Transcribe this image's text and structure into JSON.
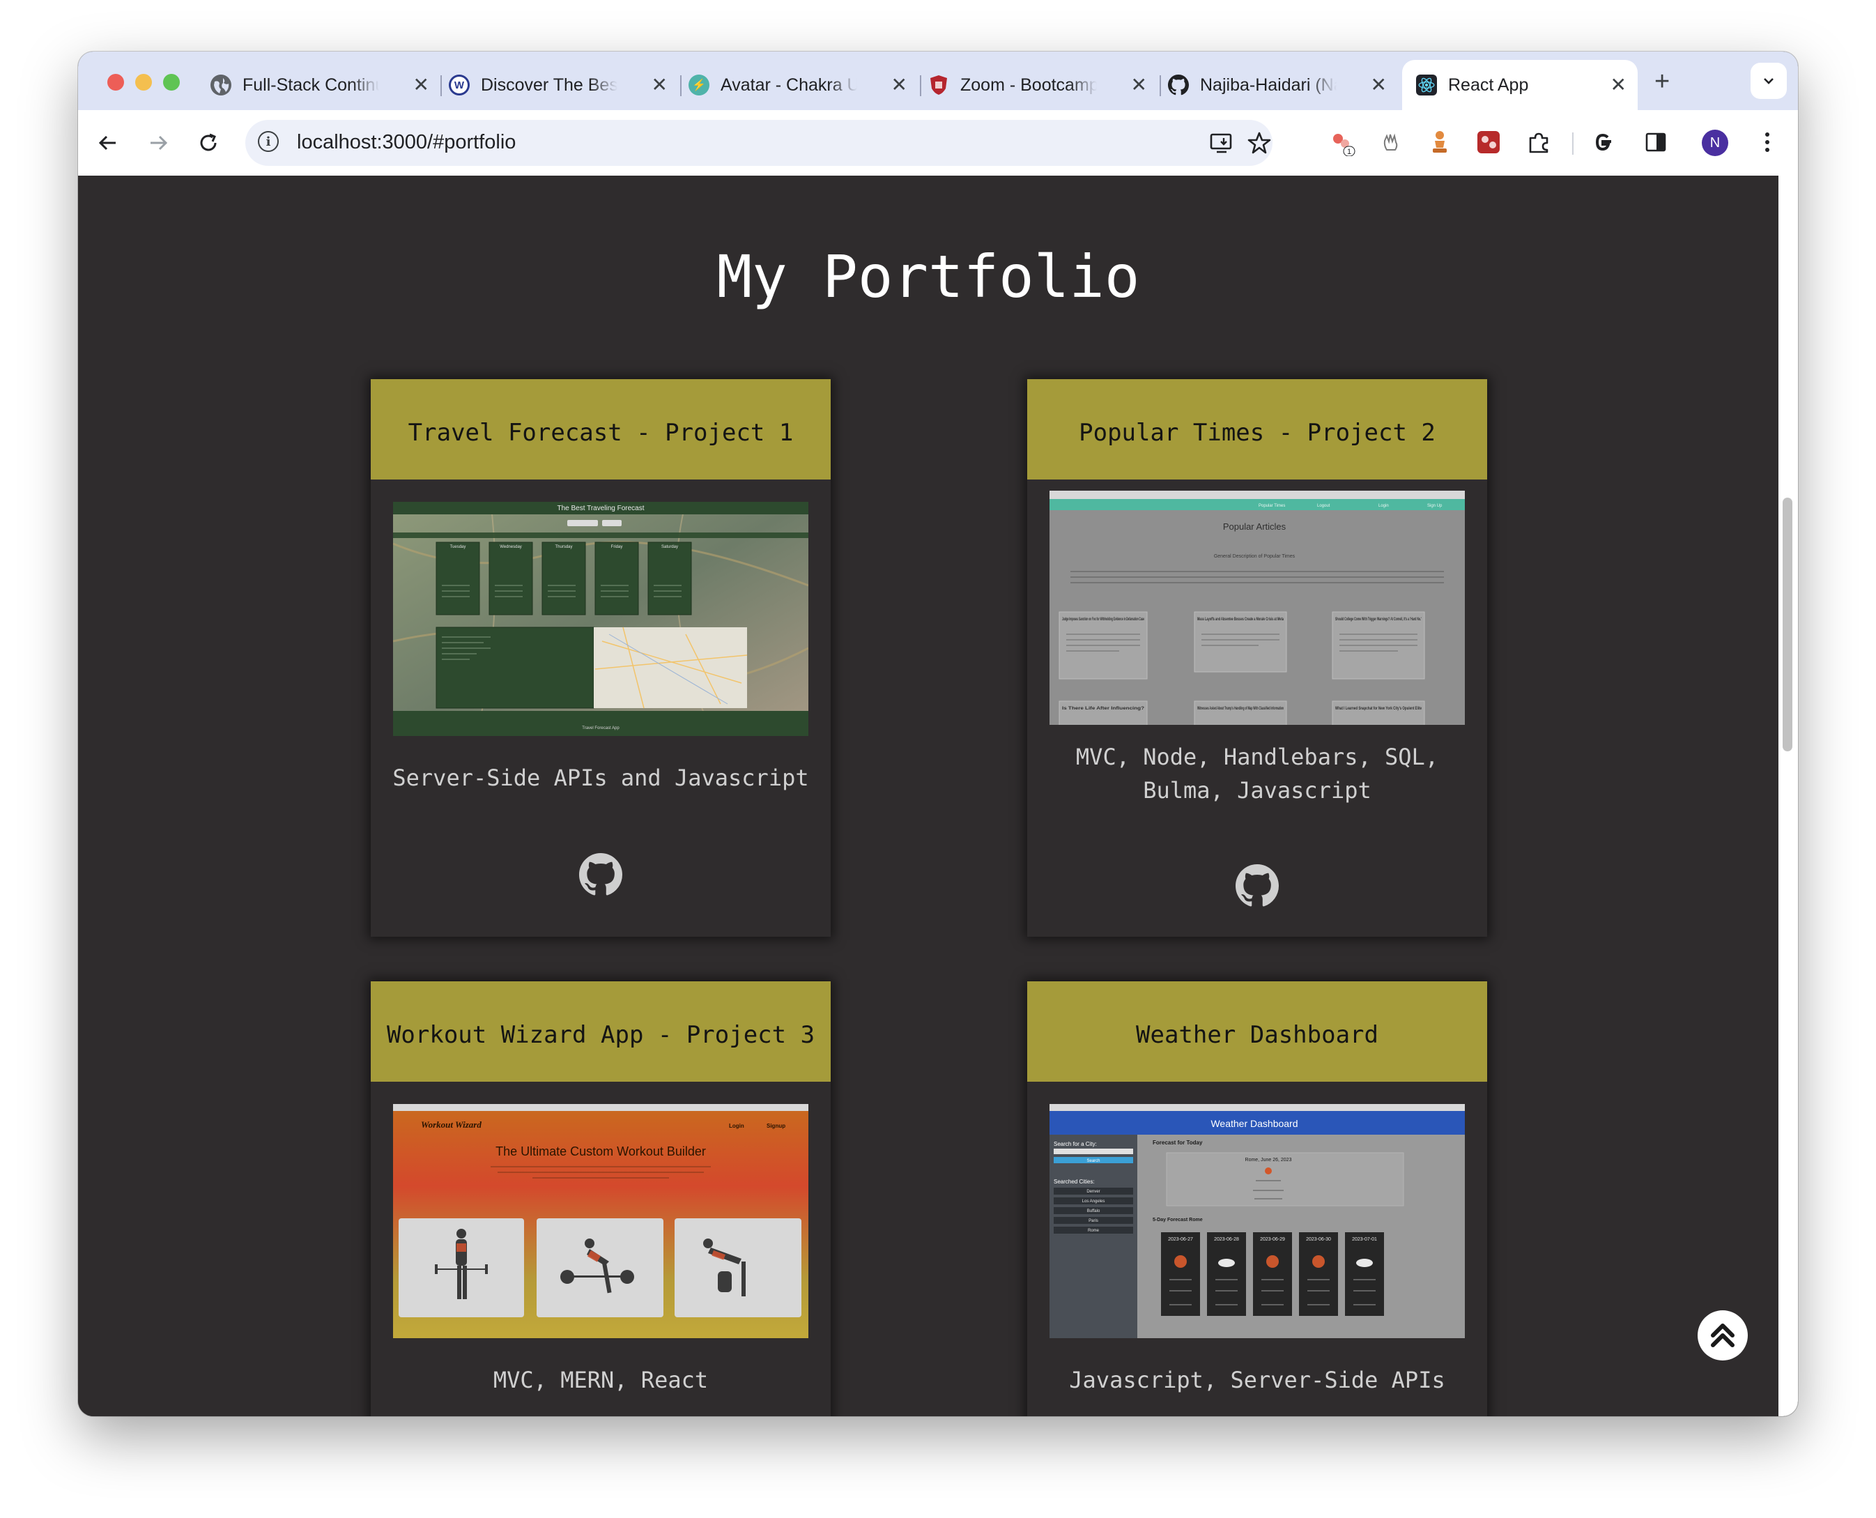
{
  "browser": {
    "tabs": [
      {
        "title": "Full-Stack Continuing",
        "favicon": "globe-icon"
      },
      {
        "title": "Discover The Best",
        "favicon": "webflow-icon"
      },
      {
        "title": "Avatar - Chakra UI",
        "favicon": "chakra-icon"
      },
      {
        "title": "Zoom - Bootcamp",
        "favicon": "shield-icon"
      },
      {
        "title": "Najiba-Haidari (Najiba)",
        "favicon": "github-icon"
      },
      {
        "title": "React App",
        "favicon": "react-icon",
        "active": true
      }
    ],
    "url": "localhost:3000/#portfolio",
    "profile_initial": "N",
    "extension_badge": "1"
  },
  "page": {
    "title": "My Portfolio",
    "cards": [
      {
        "title": "Travel Forecast - Project 1",
        "description": "Server-Side APIs and Javascript",
        "link_icon": "github-icon"
      },
      {
        "title": "Popular Times - Project 2",
        "description": "MVC, Node, Handlebars, SQL, Bulma, Javascript",
        "link_icon": "github-icon"
      },
      {
        "title": "Workout Wizard App - Project 3",
        "description": "MVC, MERN, React"
      },
      {
        "title": "Weather Dashboard",
        "description": "Javascript, Server-Side APIs"
      }
    ],
    "thumbnails": {
      "travel": {
        "heading": "The Best Traveling Forecast",
        "days": [
          "Tuesday",
          "Wednesday",
          "Thursday",
          "Friday",
          "Saturday"
        ],
        "footer": "Travel Forecast App"
      },
      "popular": {
        "heading": "Popular Articles",
        "nav": [
          "Popular Times",
          "Logout",
          "Login",
          "Sign Up"
        ],
        "subheading": "General Description of Popular Times",
        "articles": [
          "Judge Imposes Sanction on Fox for Withholding Evidence in Defamation Case",
          "Mass Layoffs and Absentee Bosses Create a Morale Crisis at Meta",
          "Should College Come With Trigger Warnings? At Cornell, It's a 'Hard No.'",
          "Is There Life After Influencing?",
          "Witnesses Asked About Trump's Handling of Map With Classified Information",
          "What I Learned Snapchat for New York City's Opulent Elite"
        ]
      },
      "workout": {
        "brand": "Workout Wizard",
        "nav": [
          "Login",
          "Signup"
        ],
        "heading": "The Ultimate Custom Workout Builder"
      },
      "weather": {
        "heading": "Weather Dashboard",
        "search_label": "Search for a City:",
        "search_button": "Search",
        "searched_label": "Searched Cities:",
        "cities": [
          "Denver",
          "Los Angeles",
          "Buffalo",
          "Paris",
          "Rome"
        ],
        "today_label": "Forecast for Today",
        "today_city": "Rome, June 26, 2023",
        "five_day_label": "5-Day Forecast Rome",
        "five_day": [
          "2023-06-27",
          "2023-06-28",
          "2023-06-29",
          "2023-06-30",
          "2023-07-01"
        ]
      }
    }
  }
}
